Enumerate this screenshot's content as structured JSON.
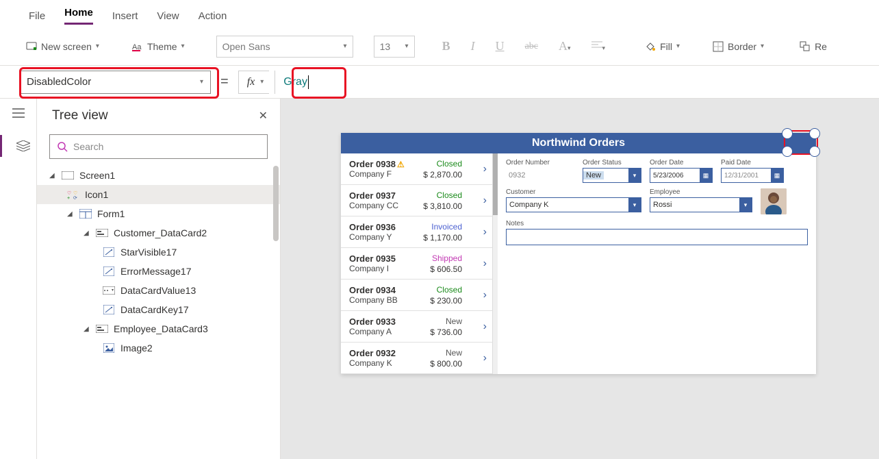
{
  "menu": {
    "file": "File",
    "home": "Home",
    "insert": "Insert",
    "view": "View",
    "action": "Action"
  },
  "ribbon": {
    "newscreen": "New screen",
    "theme": "Theme",
    "font": "Open Sans",
    "fontsize": "13",
    "fill": "Fill",
    "border": "Border",
    "reorder": "Re"
  },
  "formula": {
    "property": "DisabledColor",
    "value": "Gray"
  },
  "tree": {
    "title": "Tree view",
    "search_ph": "Search",
    "screen": "Screen1",
    "icon": "Icon1",
    "form": "Form1",
    "card1": "Customer_DataCard2",
    "c1a": "StarVisible17",
    "c1b": "ErrorMessage17",
    "c1c": "DataCardValue13",
    "c1d": "DataCardKey17",
    "card2": "Employee_DataCard3",
    "c2a": "Image2"
  },
  "app": {
    "title": "Northwind Orders",
    "gallery": [
      {
        "order": "Order 0938",
        "company": "Company F",
        "status": "Closed",
        "scls": "s-closed",
        "amt": "$ 2,870.00",
        "warn": true
      },
      {
        "order": "Order 0937",
        "company": "Company CC",
        "status": "Closed",
        "scls": "s-closed",
        "amt": "$ 3,810.00"
      },
      {
        "order": "Order 0936",
        "company": "Company Y",
        "status": "Invoiced",
        "scls": "s-invoiced",
        "amt": "$ 1,170.00"
      },
      {
        "order": "Order 0935",
        "company": "Company I",
        "status": "Shipped",
        "scls": "s-shipped",
        "amt": "$ 606.50"
      },
      {
        "order": "Order 0934",
        "company": "Company BB",
        "status": "Closed",
        "scls": "s-closed",
        "amt": "$ 230.00"
      },
      {
        "order": "Order 0933",
        "company": "Company A",
        "status": "New",
        "scls": "s-new",
        "amt": "$ 736.00"
      },
      {
        "order": "Order 0932",
        "company": "Company K",
        "status": "New",
        "scls": "s-new",
        "amt": "$ 800.00"
      }
    ],
    "labels": {
      "ordernum": "Order Number",
      "orderstatus": "Order Status",
      "orderdate": "Order Date",
      "paiddate": "Paid Date",
      "customer": "Customer",
      "employee": "Employee",
      "notes": "Notes"
    },
    "detail": {
      "ordernum": "0932",
      "status": "New",
      "orderdate": "5/23/2006",
      "paiddate": "12/31/2001",
      "customer": "Company K",
      "employee": "Rossi"
    }
  }
}
